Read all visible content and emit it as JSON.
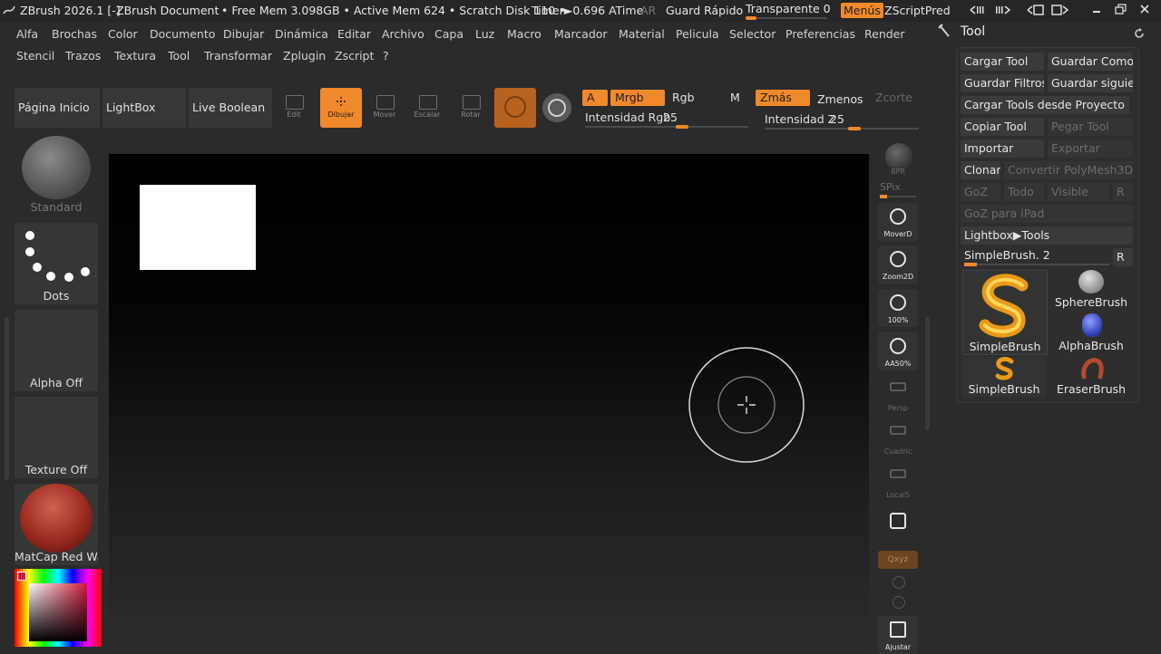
{
  "titlebar": {
    "app": "ZBrush 2026.1 [-]",
    "document": "ZBrush Document",
    "mem": "• Free Mem 3.098GB • Active Mem 624 • Scratch Disk 110 •",
    "timer": "Timer►0.696 ATime",
    "ar": "AR",
    "quicksave": "Guard Rápido",
    "transparent": "Transparente 0",
    "menus": "Menús",
    "zscriptpred": "ZScriptPred"
  },
  "menu_row1": [
    "Alfa",
    "Brochas",
    "Color",
    "Documento",
    "Dibujar",
    "Dinámica",
    "Editar",
    "Archivo",
    "Capa",
    "Luz",
    "Macro",
    "Marcador",
    "Material",
    "Pelicula",
    "Selector",
    "Preferencias",
    "Render"
  ],
  "menu_row2": [
    "Stencil",
    "Trazos",
    "Textura",
    "Tool",
    "Transformar",
    "Zplugin",
    "Zscript",
    "?"
  ],
  "shelf": {
    "home": "Página Inicio",
    "lightbox": "LightBox",
    "liveboolean": "Live Boolean",
    "tools": [
      {
        "label": "Edit",
        "icon": "edit-icon"
      },
      {
        "label": "Dibujar",
        "icon": "draw-icon",
        "active": true
      },
      {
        "label": "Mover",
        "icon": "move-icon"
      },
      {
        "label": "Escalar",
        "icon": "scale-icon"
      },
      {
        "label": "Rotar",
        "icon": "rotate-icon"
      }
    ],
    "a": "A",
    "mrgb": "Mrgb",
    "rgb": "Rgb",
    "m": "M",
    "zmas": "Zmás",
    "zmenos": "Zmenos",
    "zcorte": "Zcorte",
    "rgb_intensity_label": "Intensidad Rgb",
    "rgb_intensity_value": "25",
    "rgb_intensity_fraction": 0.25,
    "z_intensity_label": "Intensidad Z",
    "z_intensity_value": "25",
    "z_intensity_fraction": 0.25
  },
  "left": {
    "brush": "Standard",
    "stroke": "Dots",
    "alpha": "Alpha Off",
    "texture": "Texture Off",
    "material": "MatCap Red Wax"
  },
  "rightbar": {
    "bpr": "BPR",
    "spix": "SPix",
    "move2d": "MoverD",
    "zoom2d": "Zoom2D",
    "hundred": "100%",
    "aa50": "AA50%",
    "persp": "Persp",
    "floor": "Cuadric",
    "local": "LocalS",
    "xyz": "Qxyz",
    "fit": "Ajustar"
  },
  "toolpanel": {
    "title": "Tool",
    "load": "Cargar Tool",
    "saveas": "Guardar Como",
    "savefilters": "Guardar Filtros",
    "savenext": "Guardar siguien",
    "loadproject": "Cargar Tools desde Proyecto",
    "copy": "Copiar Tool",
    "paste": "Pegar Tool",
    "import": "Importar",
    "export": "Exportar",
    "clone": "Clonar",
    "convert": "Convertir PolyMesh3D",
    "goz": "GoZ",
    "all": "Todo",
    "visible": "Visible",
    "r": "R",
    "gozipad": "GoZ para iPad",
    "lightboxtools": "Lightbox▶Tools",
    "current": "SimpleBrush. 2",
    "brushes": [
      "SimpleBrush",
      "SphereBrush",
      "AlphaBrush",
      "SimpleBrush",
      "EraserBrush"
    ]
  },
  "colors": {
    "accent": "#f0892b",
    "panel": "#2e2e2e",
    "background": "#2b2b2b"
  }
}
